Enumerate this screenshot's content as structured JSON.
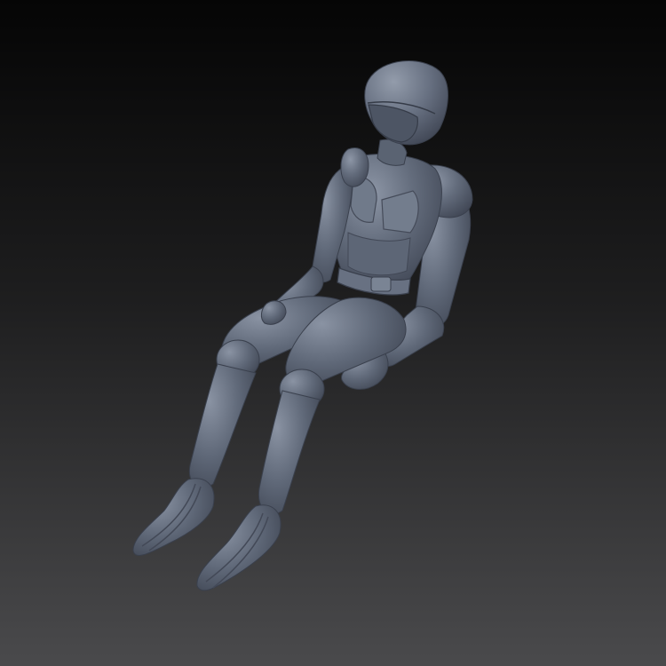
{
  "scene": {
    "subject": "seated-pilot-figure-3d-model",
    "background_top": "#050505",
    "background_bottom": "#4a4a4c",
    "model_base_color": "#5f6878",
    "model_highlight_color": "#8d96a6",
    "model_shadow_color": "#3c4250"
  }
}
